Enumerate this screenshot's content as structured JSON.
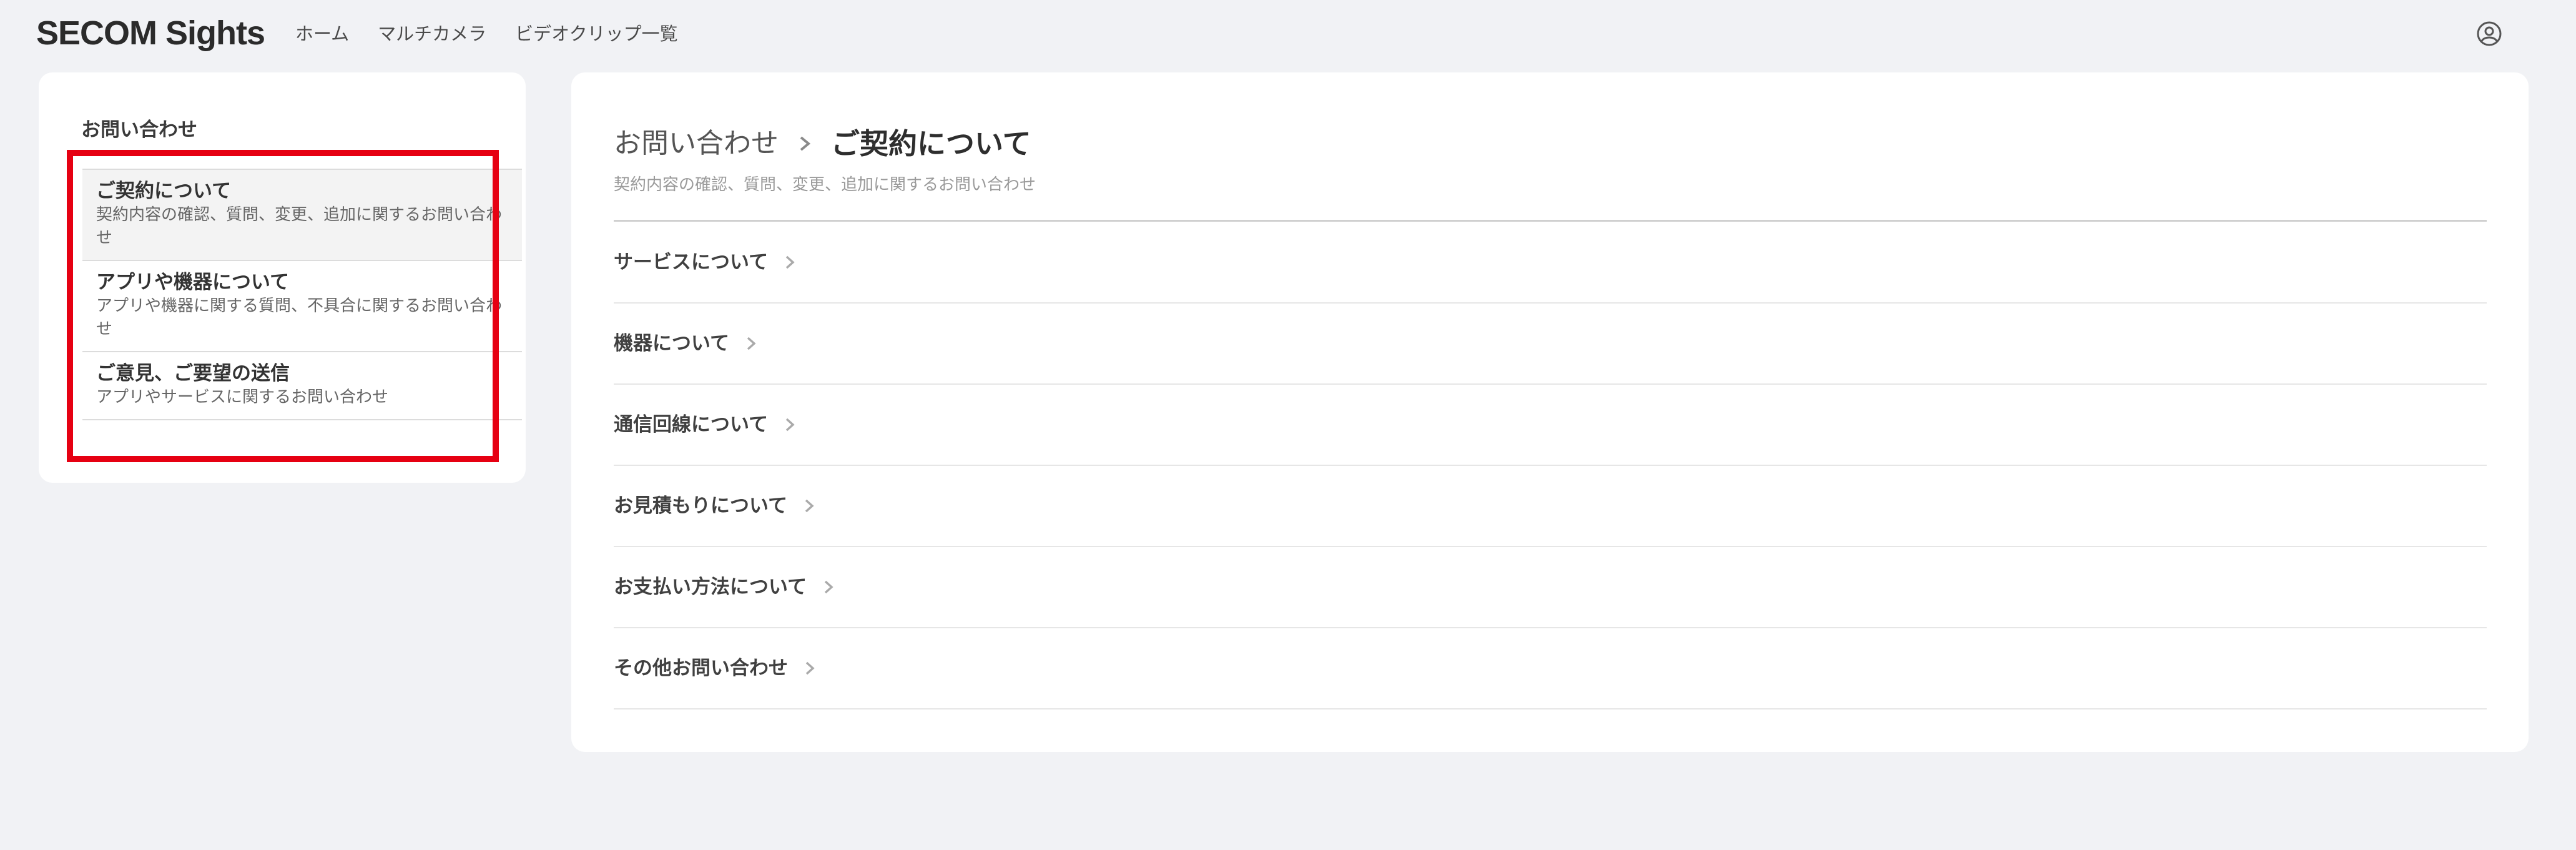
{
  "header": {
    "logo": "SECOM Sights",
    "nav": [
      "ホーム",
      "マルチカメラ",
      "ビデオクリップ一覧"
    ],
    "user_icon": "user-circle-icon"
  },
  "sidebar": {
    "title": "お問い合わせ",
    "items": [
      {
        "title": "ご契約について",
        "desc": "契約内容の確認、質問、変更、追加に関するお問い合わせ",
        "active": true
      },
      {
        "title": "アプリや機器について",
        "desc": "アプリや機器に関する質問、不具合に関するお問い合わせ",
        "active": false
      },
      {
        "title": "ご意見、ご要望の送信",
        "desc": "アプリやサービスに関するお問い合わせ",
        "active": false
      }
    ],
    "highlight_color": "#e60012"
  },
  "main": {
    "breadcrumb_parent": "お問い合わせ",
    "breadcrumb_current": "ご契約について",
    "subtitle": "契約内容の確認、質問、変更、追加に関するお問い合わせ",
    "menu": [
      "サービスについて",
      "機器について",
      "通信回線について",
      "お見積もりについて",
      "お支払い方法について",
      "その他お問い合わせ"
    ]
  }
}
